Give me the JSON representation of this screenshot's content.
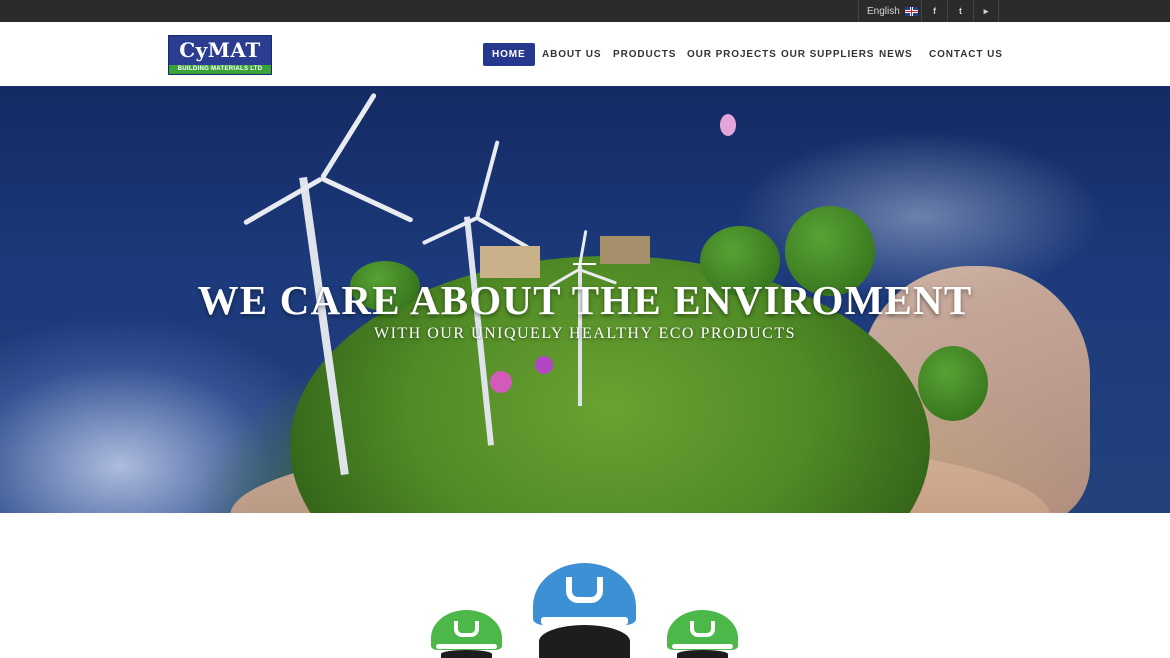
{
  "topbar": {
    "language": "English",
    "language_flag_icon": "uk-flag-icon",
    "social": [
      {
        "name": "facebook-icon",
        "glyph": "f"
      },
      {
        "name": "twitter-icon",
        "glyph": "t"
      },
      {
        "name": "youtube-icon",
        "glyph": "▸"
      }
    ]
  },
  "header": {
    "logo": {
      "word": "CyMAT",
      "tagline": "BUILDING MATERIALS LTD"
    },
    "nav": [
      {
        "label": "HOME",
        "active": true
      },
      {
        "label": "ABOUT US",
        "active": false
      },
      {
        "label": "PRODUCTS",
        "active": false
      },
      {
        "label": "OUR PROJECTS",
        "active": false
      },
      {
        "label": "OUR SUPPLIERS",
        "active": false
      },
      {
        "label": "NEWS",
        "active": false
      },
      {
        "label": "CONTACT US",
        "active": false
      }
    ]
  },
  "hero": {
    "title": "WE CARE ABOUT THE ENVIROMENT",
    "subtitle": "WITH OUR UNIQUELY HEALTHY ECO PRODUCTS"
  },
  "colors": {
    "brand_blue": "#26388d",
    "brand_green": "#3aa43a",
    "topbar_bg": "#2b2b2b",
    "helmet_blue": "#3e90d4",
    "helmet_green": "#4cb84a"
  },
  "helmets": [
    "helmet-green-icon",
    "helmet-blue-icon",
    "helmet-green-icon"
  ]
}
